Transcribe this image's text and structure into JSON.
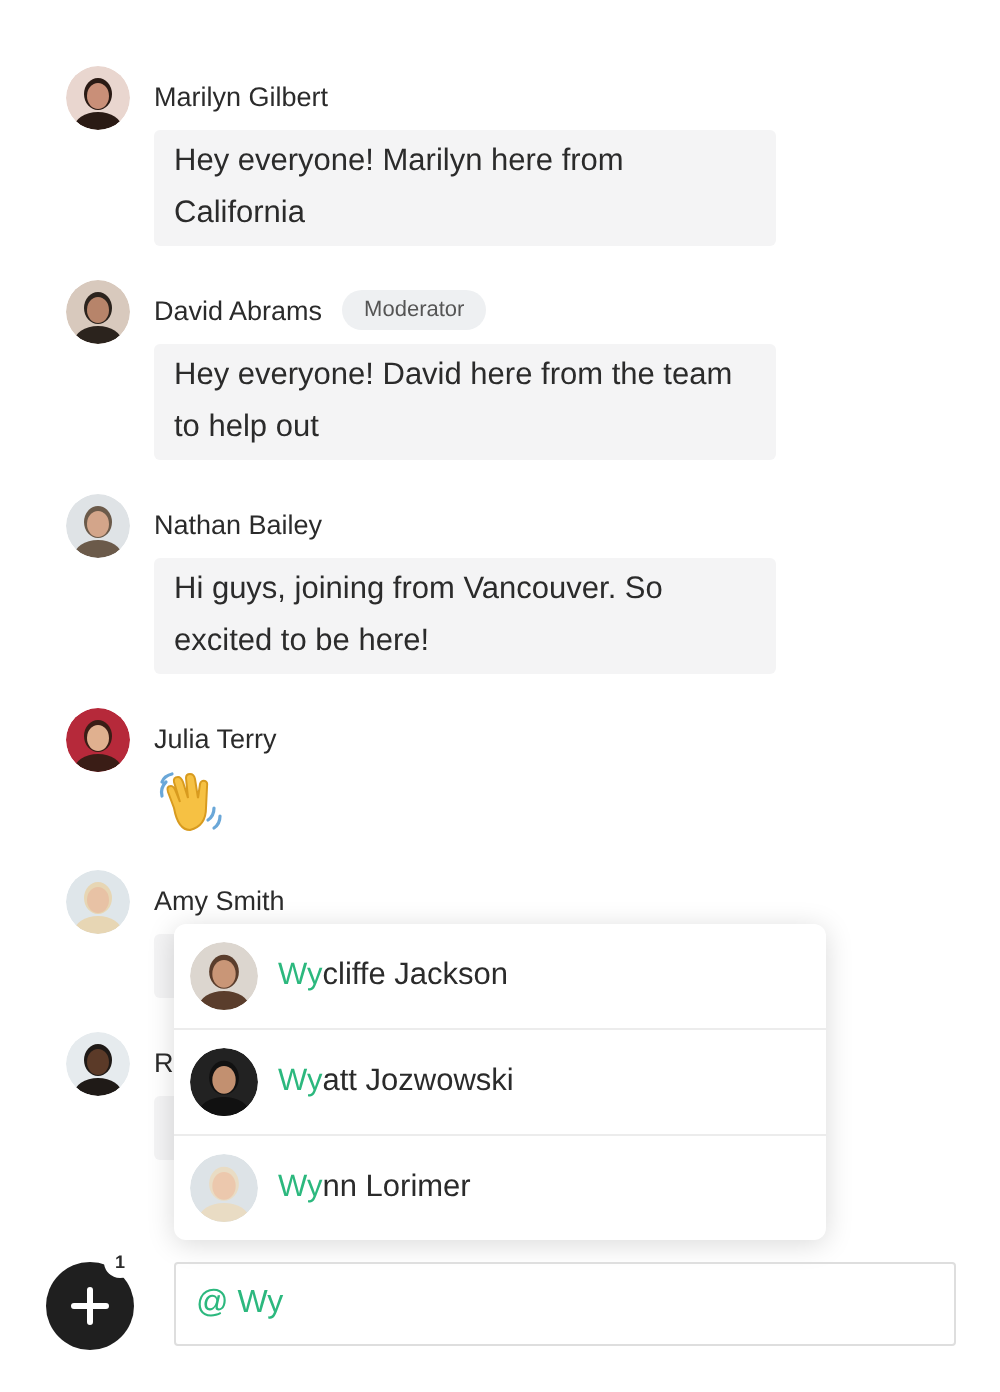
{
  "messages": [
    {
      "author": "Marilyn Gilbert",
      "kind": "text",
      "text": "Hey everyone! Marilyn here from California"
    },
    {
      "author": "David Abrams",
      "badge": "Moderator",
      "kind": "text",
      "text": "Hey everyone! David here from the team to help out"
    },
    {
      "author": "Nathan Bailey",
      "kind": "text",
      "text": "Hi guys, joining from Vancouver. So excited to be here!"
    },
    {
      "author": "Julia Terry",
      "kind": "wave"
    },
    {
      "author": "Amy Smith",
      "kind": "covered"
    },
    {
      "author": "R",
      "kind": "covered"
    }
  ],
  "mention_suggestions": [
    {
      "match": "Wy",
      "rest": "cliffe Jackson"
    },
    {
      "match": "Wy",
      "rest": "att Jozwowski"
    },
    {
      "match": "Wy",
      "rest": "nn Lorimer"
    }
  ],
  "composer": {
    "badge": "1",
    "at": "@",
    "value": "Wy"
  }
}
